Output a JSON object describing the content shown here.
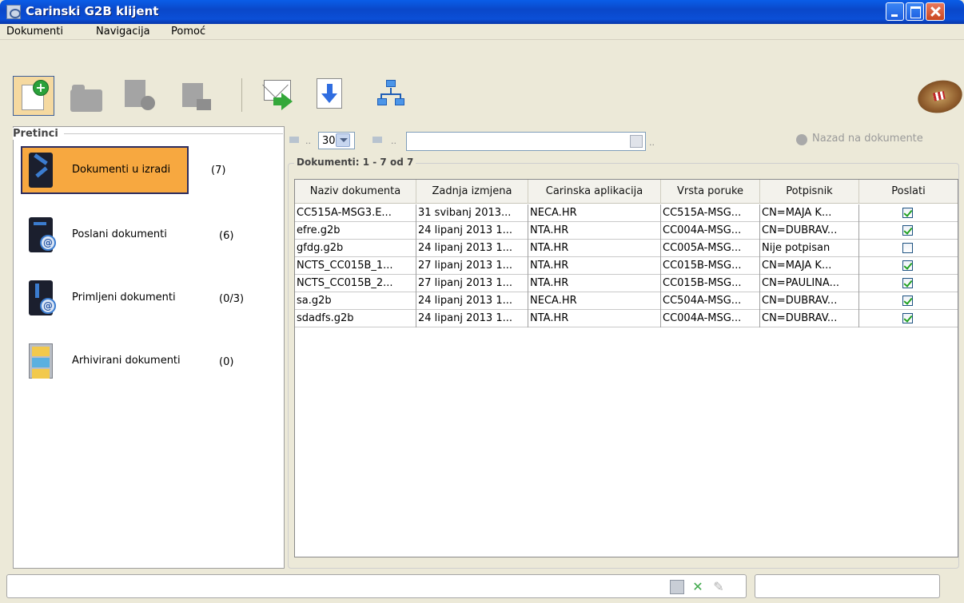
{
  "window": {
    "title": "Carinski G2B klijent",
    "icon": "app-icon",
    "controls": [
      "minimize",
      "maximize",
      "close"
    ]
  },
  "menu": {
    "items": [
      {
        "label": "Dokumenti"
      },
      {
        "label": "Navigacija"
      },
      {
        "label": "Pomoć"
      }
    ]
  },
  "toolbar": {
    "icons": [
      "new-document-icon",
      "open-folder-icon",
      "delete-document-icon",
      "unlock-icon",
      "send-mail-icon",
      "download-icon",
      "network-icon",
      "croatian-customs-logo"
    ]
  },
  "sidebar": {
    "title": "Pretinci",
    "folders": [
      {
        "label": "Dokumenti u izradi",
        "count": "(7)",
        "active": true
      },
      {
        "label": "Poslani dokumenti",
        "count": "(6)",
        "active": false
      },
      {
        "label": "Primljeni dokumenti",
        "count": "(0/3)",
        "active": false
      },
      {
        "label": "Arhivirani dokumenti",
        "count": "(0)",
        "active": false
      }
    ]
  },
  "navigation": {
    "page_size": "30",
    "filter_value": "",
    "back_label": "Nazad na dokumente"
  },
  "documents": {
    "title": "Dokumenti: 1 - 7 od 7",
    "columns": [
      "Naziv dokumenta",
      "Zadnja izmjena",
      "Carinska aplikacija",
      "Vrsta poruke",
      "Potpisnik",
      "Poslati"
    ],
    "rows": [
      {
        "name": "CC515A-MSG3.E...",
        "modified": "31 svibanj 2013...",
        "app": "NECA.HR",
        "type": "CC515A-MSG...",
        "signer": "CN=MAJA K...",
        "send": true
      },
      {
        "name": "efre.g2b",
        "modified": "24 lipanj 2013 1...",
        "app": "NTA.HR",
        "type": "CC004A-MSG...",
        "signer": "CN=DUBRAV...",
        "send": true
      },
      {
        "name": "gfdg.g2b",
        "modified": "24 lipanj 2013 1...",
        "app": "NTA.HR",
        "type": "CC005A-MSG...",
        "signer": "Nije potpisan",
        "send": false
      },
      {
        "name": "NCTS_CC015B_1...",
        "modified": "27 lipanj 2013 1...",
        "app": "NTA.HR",
        "type": "CC015B-MSG...",
        "signer": "CN=MAJA K...",
        "send": true
      },
      {
        "name": "NCTS_CC015B_2...",
        "modified": "27 lipanj 2013 1...",
        "app": "NTA.HR",
        "type": "CC015B-MSG...",
        "signer": "CN=PAULINA...",
        "send": true
      },
      {
        "name": "sa.g2b",
        "modified": "24 lipanj 2013 1...",
        "app": "NECA.HR",
        "type": "CC504A-MSG...",
        "signer": "CN=DUBRAV...",
        "send": true
      },
      {
        "name": "sdadfs.g2b",
        "modified": "24 lipanj 2013 1...",
        "app": "NTA.HR",
        "type": "CC004A-MSG...",
        "signer": "CN=DUBRAV...",
        "send": true
      }
    ]
  },
  "statusbar": {
    "message": "",
    "right_field": ""
  },
  "colors": {
    "title_bar": "#0a5ee8",
    "active_folder": "#f7a840",
    "background": "#ece9d8",
    "checkbox_check": "#21a121"
  }
}
